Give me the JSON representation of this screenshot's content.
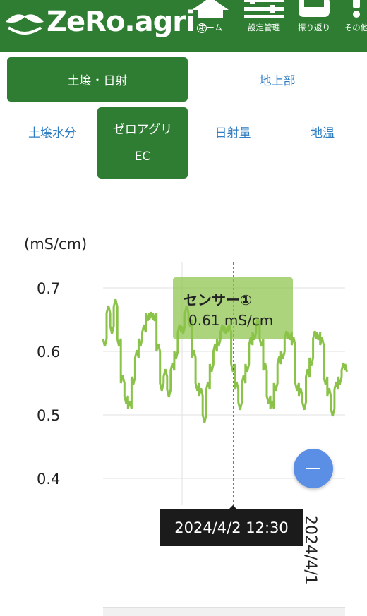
{
  "header": {
    "logo_text": "ZeRo.agri",
    "logo_mark": "R",
    "nav": [
      {
        "label": "ホーム",
        "icon": "home-icon"
      },
      {
        "label": "設定管理",
        "icon": "sliders-icon"
      },
      {
        "label": "振り返り",
        "icon": "clipboard-icon"
      },
      {
        "label": "その他",
        "icon": "more-icon"
      }
    ],
    "color": "#2e7d32"
  },
  "tabs_row1": [
    {
      "label": "土壌・日射",
      "active": true
    },
    {
      "label": "地上部",
      "active": false
    }
  ],
  "tabs_row2": [
    {
      "label": "土壌水分",
      "active": false
    },
    {
      "label_line1": "ゼロアグリ",
      "label_line2": "EC",
      "active": true
    },
    {
      "label": "日射量",
      "active": false
    },
    {
      "label": "地温",
      "active": false
    }
  ],
  "chart": {
    "unit_label": "(mS/cm)",
    "tooltip_series": "センサー①",
    "tooltip_value": "0.61 mS/cm",
    "crosshair_date": "2024/4/2 12:30",
    "x_tick_label": "2024/4/1",
    "zoom_button": "—",
    "line_color": "#8bc34a"
  },
  "chart_data": {
    "type": "line",
    "ylabel": "(mS/cm)",
    "ylim": [
      0.4,
      0.7
    ],
    "y_ticks": [
      0.7,
      0.6,
      0.5,
      0.4
    ],
    "series": [
      {
        "name": "センサー①",
        "values": [
          0.62,
          0.66,
          0.64,
          0.67,
          0.62,
          0.55,
          0.53,
          0.51,
          0.56,
          0.59,
          0.62,
          0.63,
          0.66,
          0.65,
          0.66,
          0.6,
          0.55,
          0.56,
          0.54,
          0.57,
          0.6,
          0.63,
          0.64,
          0.66,
          0.65,
          0.59,
          0.55,
          0.53,
          0.5,
          0.54,
          0.58,
          0.6,
          0.62,
          0.63,
          0.64,
          0.63,
          0.58,
          0.54,
          0.52,
          0.55,
          0.58,
          0.61,
          0.63,
          0.64,
          0.62,
          0.57,
          0.53,
          0.51,
          0.55,
          0.58,
          0.6,
          0.62,
          0.63,
          0.61,
          0.55,
          0.53,
          0.52,
          0.56,
          0.59,
          0.62,
          0.63,
          0.61,
          0.56,
          0.53,
          0.51,
          0.54,
          0.56,
          0.57,
          0.58
        ]
      }
    ],
    "crosshair_index": 37,
    "tooltip_value": 0.61
  }
}
